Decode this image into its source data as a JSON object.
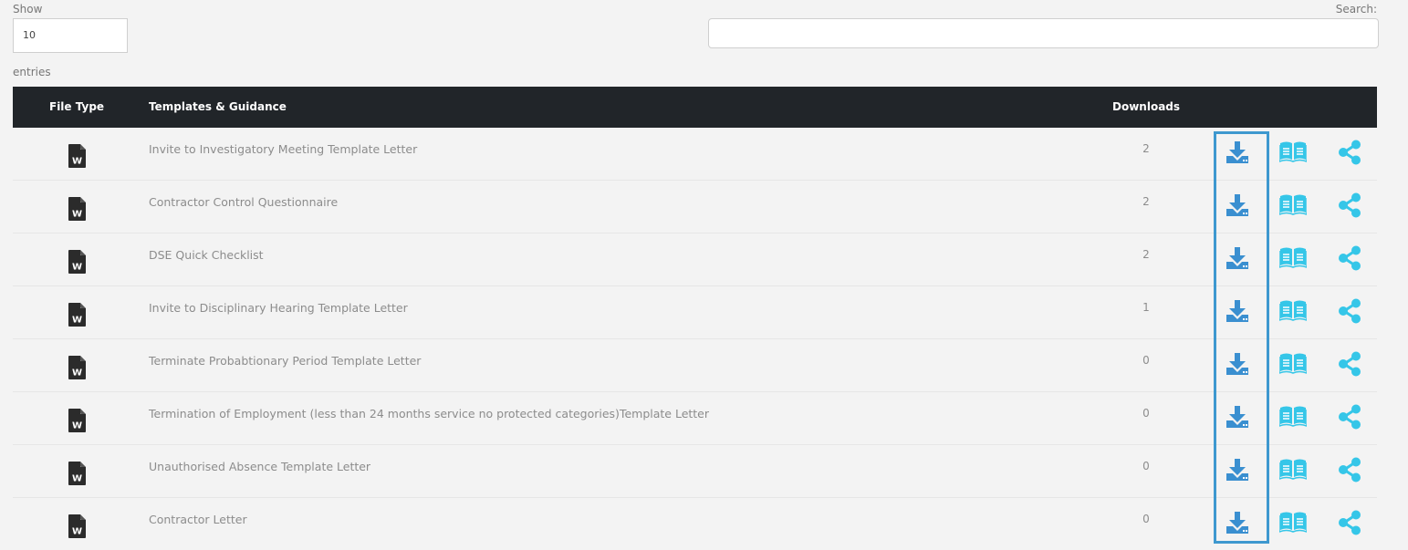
{
  "length": {
    "label": "Show",
    "value": "10",
    "suffix": "entries"
  },
  "search": {
    "label": "Search:",
    "placeholder": ""
  },
  "table": {
    "headers": {
      "file_type": "File Type",
      "templates": "Templates & Guidance",
      "downloads": "Downloads"
    },
    "rows": [
      {
        "file_type_icon": "word-document-icon",
        "name": "Invite to Investigatory Meeting Template Letter",
        "downloads": "2"
      },
      {
        "file_type_icon": "word-document-icon",
        "name": "Contractor Control Questionnaire",
        "downloads": "2"
      },
      {
        "file_type_icon": "word-document-icon",
        "name": "DSE Quick Checklist",
        "downloads": "2"
      },
      {
        "file_type_icon": "word-document-icon",
        "name": "Invite to Disciplinary Hearing Template Letter",
        "downloads": "1"
      },
      {
        "file_type_icon": "word-document-icon",
        "name": "Terminate Probabtionary Period Template Letter",
        "downloads": "0"
      },
      {
        "file_type_icon": "word-document-icon",
        "name": "Termination of Employment (less than 24 months service no protected categories)Template Letter",
        "downloads": "0"
      },
      {
        "file_type_icon": "word-document-icon",
        "name": "Unauthorised Absence Template Letter",
        "downloads": "0"
      },
      {
        "file_type_icon": "word-document-icon",
        "name": "Contractor Letter",
        "downloads": "0"
      }
    ],
    "row_actions": [
      "download-icon",
      "guidance-book-icon",
      "share-icon"
    ]
  },
  "colors": {
    "header_bg": "#212529",
    "download_icon": "#3a8fd0",
    "book_icon": "#35c6e8",
    "share_icon": "#35c6e8",
    "highlight": "#3e98cf"
  }
}
